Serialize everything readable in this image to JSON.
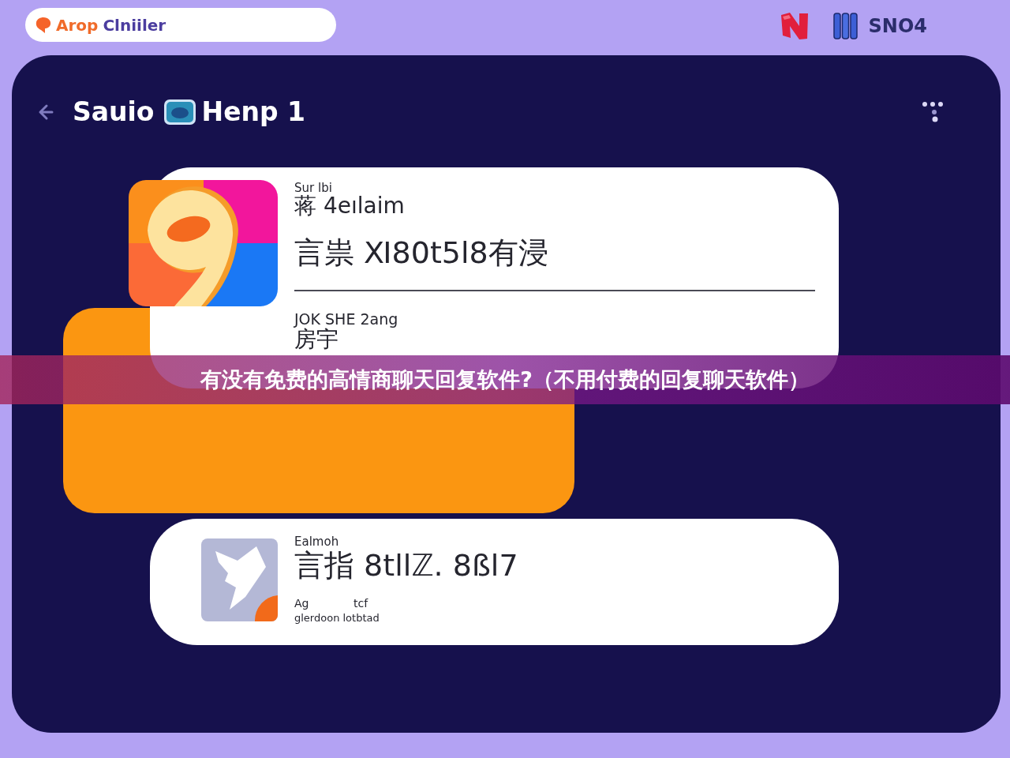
{
  "top_bar": {
    "brand_prefix": "Arop",
    "brand_suffix": "Clniiler",
    "partner_text": "SNO4"
  },
  "header": {
    "title_start": "Sauio",
    "title_end": "Henp 1"
  },
  "cards": [
    {
      "kind": "detailed",
      "label": "Sur lbi",
      "subtitle": "蒋 4eılaim",
      "headline": "言祟 Ⅺ80t5l8有浸",
      "footer_label": "JOK SHE 2ang",
      "footer_text": "房宇"
    },
    {
      "kind": "compact",
      "label": "Ealmoh",
      "headline": "言指 8tllℤ. 8ßl7",
      "meta_top": [
        "Ag",
        "tcf"
      ],
      "meta_bottom": "glerdoon lotbtad"
    }
  ],
  "banner": {
    "text": "有没有免费的高情商聊天回复软件?（不用付费的回复聊天软件）"
  }
}
